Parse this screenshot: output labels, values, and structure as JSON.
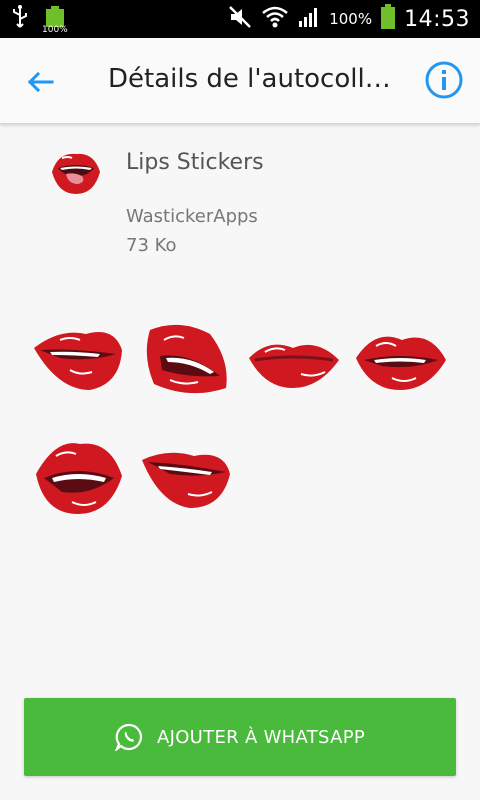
{
  "status_bar": {
    "battery_small_label": "100%",
    "battery_percent": "100%",
    "time": "14:53"
  },
  "app_bar": {
    "title": "Détails de l'autocoll…",
    "back_icon": "arrow-back-icon",
    "info_icon": "info-icon"
  },
  "pack": {
    "name": "Lips Stickers",
    "publisher": "WastickerApps",
    "size": "73 Ko"
  },
  "stickers": [
    {
      "name": "lips-sticker-1"
    },
    {
      "name": "lips-sticker-2"
    },
    {
      "name": "lips-sticker-3"
    },
    {
      "name": "lips-sticker-4"
    },
    {
      "name": "lips-sticker-5"
    },
    {
      "name": "lips-sticker-6"
    }
  ],
  "button": {
    "label": "AJOUTER À WHATSAPP",
    "icon": "whatsapp-icon"
  },
  "colors": {
    "accent": "#2196f3",
    "button": "#4aba3c",
    "lips": "#d01820"
  }
}
